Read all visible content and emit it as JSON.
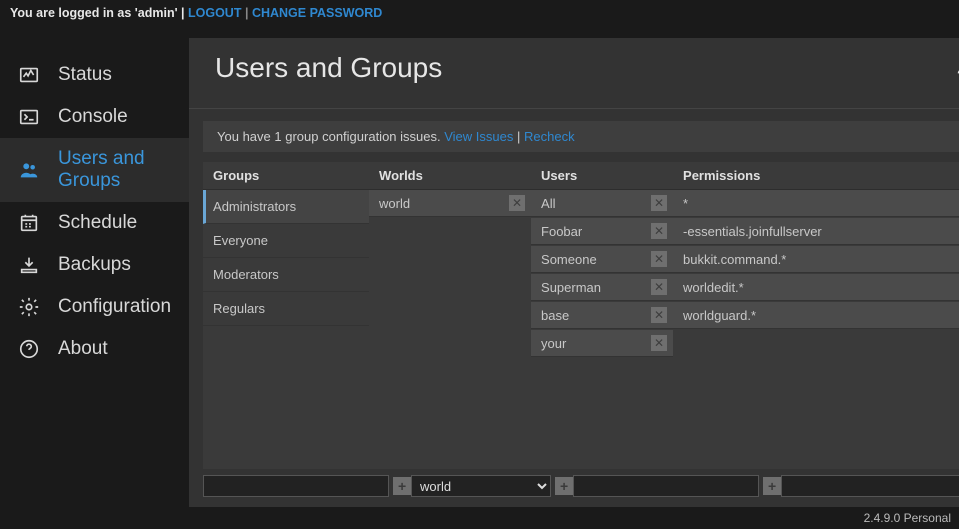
{
  "topbar": {
    "prefix": "You are logged in as 'admin' | ",
    "logout_label": "LOGOUT",
    "change_password_label": "CHANGE PASSWORD"
  },
  "sidebar": {
    "items": [
      {
        "label": "Status",
        "icon": "status"
      },
      {
        "label": "Console",
        "icon": "console"
      },
      {
        "label": "Users and Groups",
        "icon": "users",
        "selected": true
      },
      {
        "label": "Schedule",
        "icon": "schedule"
      },
      {
        "label": "Backups",
        "icon": "backups"
      },
      {
        "label": "Configuration",
        "icon": "gear"
      },
      {
        "label": "About",
        "icon": "help"
      }
    ]
  },
  "header": {
    "title": "Users and Groups"
  },
  "notice": {
    "text": "You have 1 group configuration issues.",
    "view_label": "View Issues",
    "recheck_label": "Recheck"
  },
  "columns": {
    "groups": {
      "header": "Groups",
      "rows": [
        "Administrators",
        "Everyone",
        "Moderators",
        "Regulars"
      ],
      "selected_index": 0
    },
    "worlds": {
      "header": "Worlds",
      "rows": [
        "world"
      ]
    },
    "users": {
      "header": "Users",
      "rows": [
        "All",
        "Foobar",
        "Someone",
        "Superman",
        "base",
        "your"
      ]
    },
    "permissions": {
      "header": "Permissions",
      "rows": [
        "*",
        "-essentials.joinfullserver",
        "bukkit.command.*",
        "worldedit.*",
        "worldguard.*"
      ]
    }
  },
  "inputs": {
    "groups_value": "",
    "worlds_value": "world",
    "users_value": "",
    "permissions_value": ""
  },
  "footer": {
    "version": "2.4.9.0 Personal"
  }
}
